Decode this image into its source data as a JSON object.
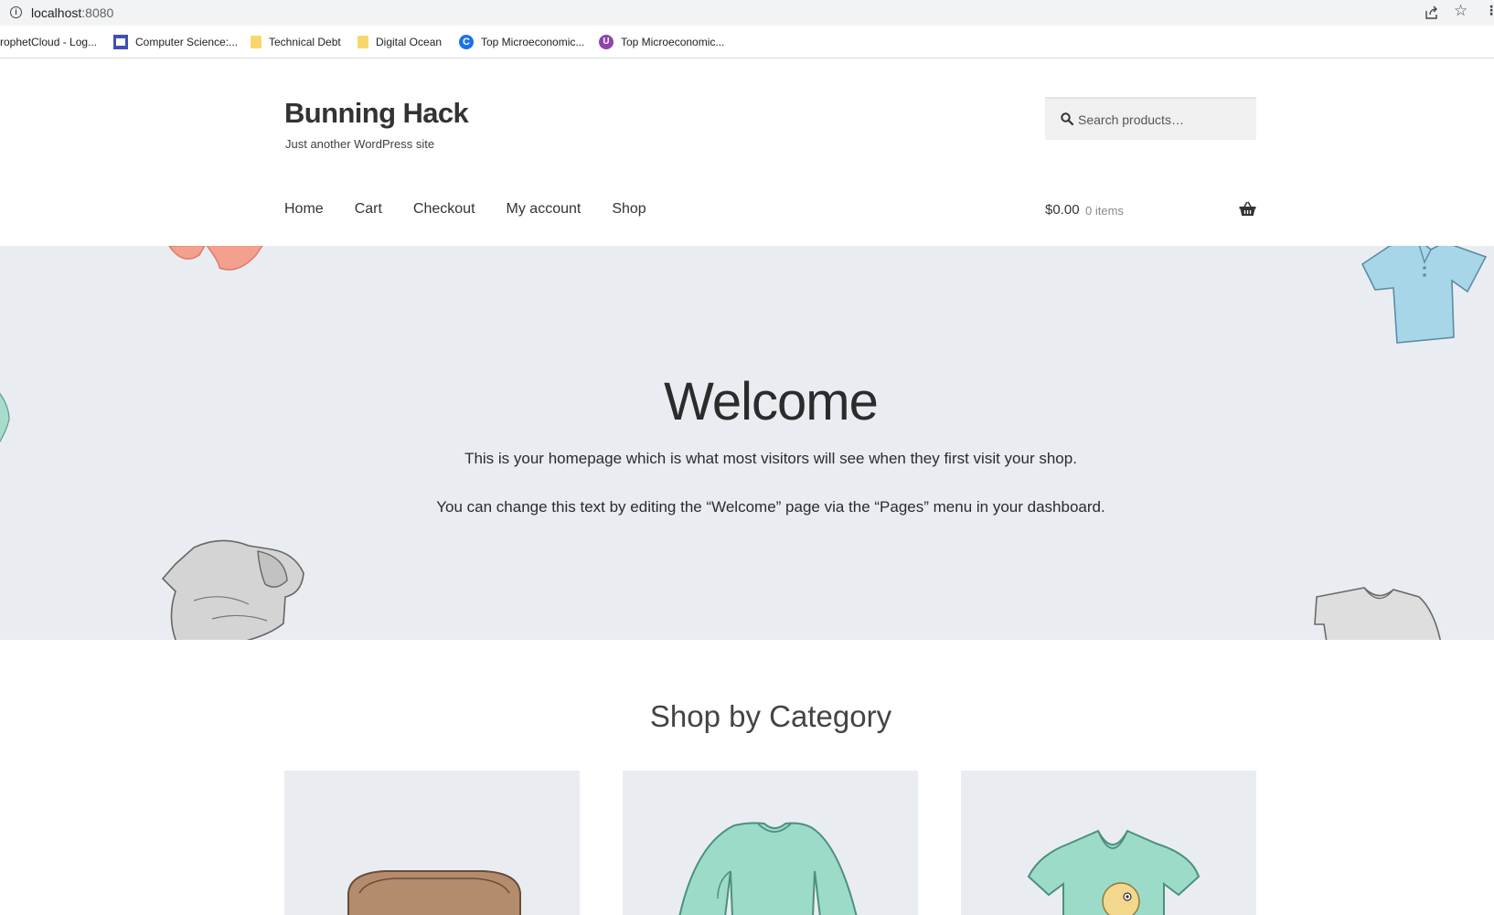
{
  "browser": {
    "url_host": "localhost",
    "url_port": ":8080",
    "bookmarks": [
      {
        "label": "rophetCloud - Log...",
        "icon": "none"
      },
      {
        "label": "Computer Science:...",
        "icon": "cs-icon"
      },
      {
        "label": "Technical Debt",
        "icon": "folder-icon"
      },
      {
        "label": "Digital Ocean",
        "icon": "folder-icon"
      },
      {
        "label": "Top Microeconomic...",
        "icon": "c-icon"
      },
      {
        "label": "Top Microeconomic...",
        "icon": "u-icon"
      }
    ]
  },
  "site": {
    "title": "Bunning Hack",
    "description": "Just another WordPress site"
  },
  "search": {
    "placeholder": "Search products…"
  },
  "nav": {
    "items": [
      "Home",
      "Cart",
      "Checkout",
      "My account",
      "Shop"
    ]
  },
  "cart": {
    "amount": "$0.00",
    "count": "0 items"
  },
  "hero": {
    "title": "Welcome",
    "paragraph1": "This is your homepage which is what most visitors will see when they first visit your shop.",
    "paragraph2": "You can change this text by editing the “Welcome” page via the “Pages” menu in your dashboard."
  },
  "categories": {
    "heading": "Shop by Category",
    "cards": [
      {
        "image": "accessories-image"
      },
      {
        "image": "hoodie-sweater-image"
      },
      {
        "image": "tshirt-image"
      }
    ]
  },
  "colors": {
    "hero_bg": "#e9edf1",
    "text": "#333333",
    "garment_mint": "#8fd6c4",
    "garment_blue": "#9fd3e6",
    "garment_gray": "#d7d7d7",
    "garment_coral": "#f08b7a"
  }
}
